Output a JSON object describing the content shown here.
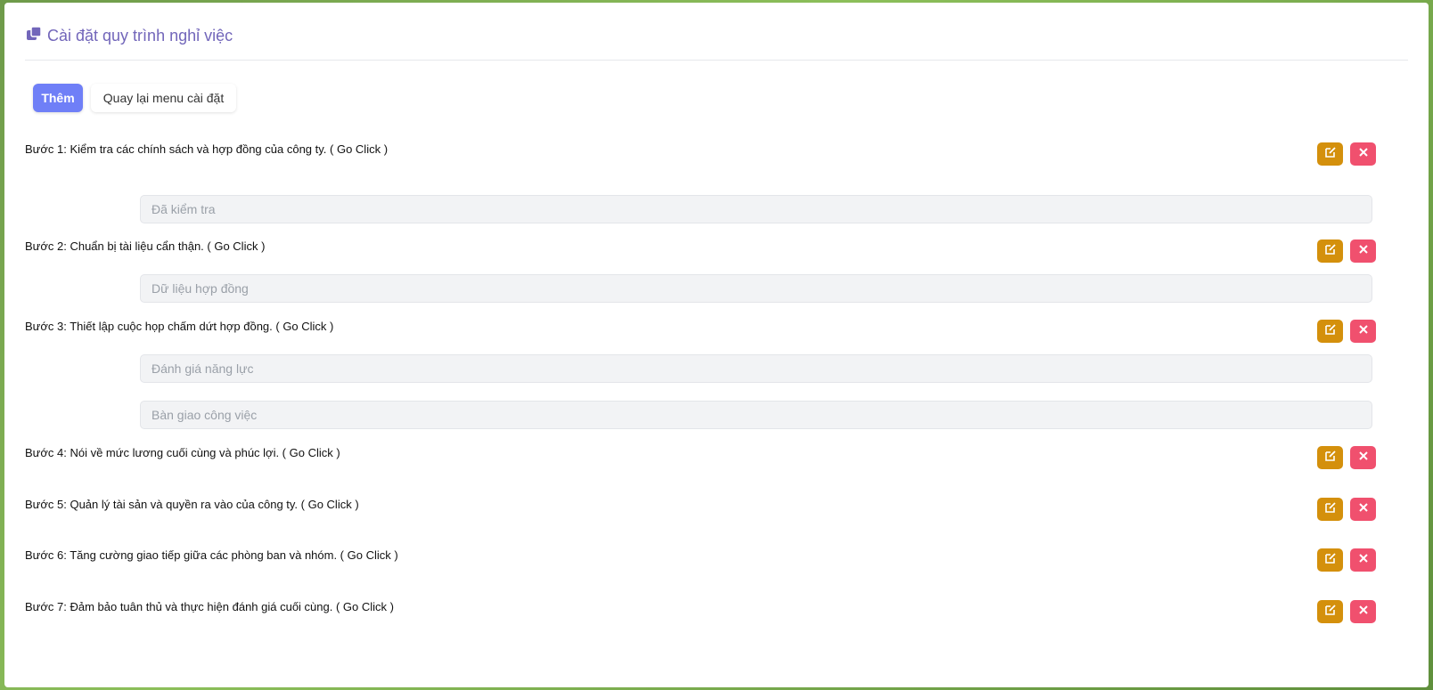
{
  "header": {
    "title": "Cài đặt quy trình nghỉ việc",
    "icon": "copy-icon",
    "color": "#7266ba"
  },
  "toolbar": {
    "add_label": "Thêm",
    "back_label": "Quay lại menu cài đặt"
  },
  "steps": [
    {
      "label": "Bước 1: Kiểm tra các chính sách và hợp đồng của công ty. ( Go Click )",
      "fields": [
        "Đã kiểm tra"
      ]
    },
    {
      "label": "Bước 2: Chuẩn bị tài liệu cẩn thận. ( Go Click )",
      "fields": [
        "Dữ liệu hợp đồng"
      ]
    },
    {
      "label": "Bước 3: Thiết lập cuộc họp chấm dứt hợp đồng. ( Go Click )",
      "fields": [
        "Đánh giá năng lực",
        "Bàn giao công việc"
      ]
    },
    {
      "label": "Bước 4: Nói về mức lương cuối cùng và phúc lợi. ( Go Click )",
      "fields": []
    },
    {
      "label": "Bước 5: Quản lý tài sản và quyền ra vào của công ty. ( Go Click )",
      "fields": []
    },
    {
      "label": "Bước 6: Tăng cường giao tiếp giữa các phòng ban và nhóm. ( Go Click )",
      "fields": []
    },
    {
      "label": "Bước 7: Đảm bảo tuân thủ và thực hiện đánh giá cuối cùng. ( Go Click )",
      "fields": []
    }
  ],
  "colors": {
    "primary": "#6f7ff7",
    "edit": "#d4900c",
    "delete": "#f0506e"
  }
}
